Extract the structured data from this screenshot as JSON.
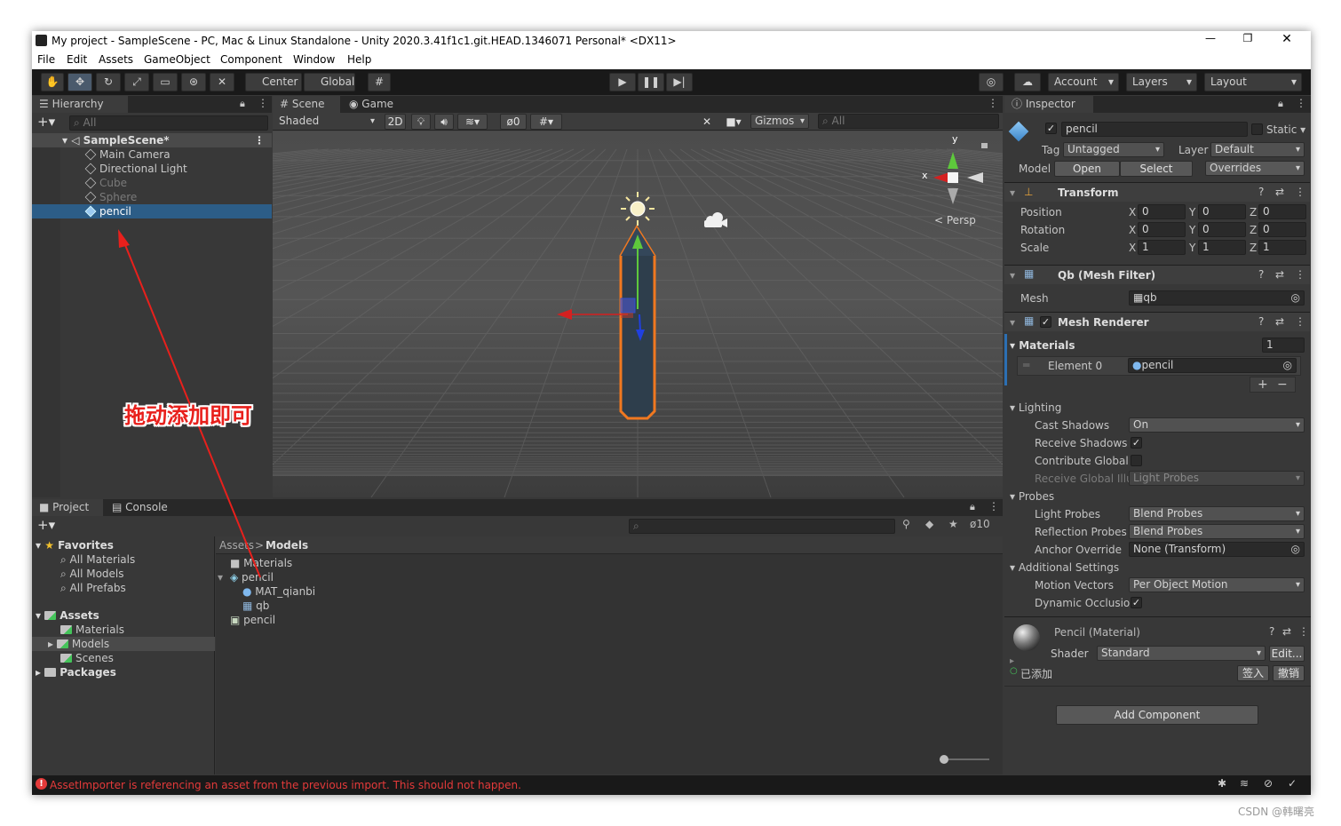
{
  "window": {
    "title": "My project - SampleScene - PC, Mac & Linux Standalone - Unity 2020.3.41f1c1.git.HEAD.1346071 Personal* <DX11>",
    "controls": {
      "minimize": "—",
      "maximize": "❐",
      "close": "✕"
    }
  },
  "menu": [
    "File",
    "Edit",
    "Assets",
    "GameObject",
    "Component",
    "Window",
    "Help"
  ],
  "toolbar": {
    "pivot": "Center",
    "space": "Global",
    "account": "Account",
    "layers": "Layers",
    "layout": "Layout"
  },
  "hierarchy": {
    "tab": "Hierarchy",
    "search_placeholder": "All",
    "scene": "SampleScene*",
    "items": [
      {
        "label": "Main Camera",
        "dim": false,
        "selected": false
      },
      {
        "label": "Directional Light",
        "dim": false,
        "selected": false
      },
      {
        "label": "Cube",
        "dim": true,
        "selected": false
      },
      {
        "label": "Sphere",
        "dim": true,
        "selected": false
      },
      {
        "label": "pencil",
        "dim": false,
        "selected": true
      }
    ]
  },
  "annotation": {
    "text": "拖动添加即可",
    "color": "#e8201c"
  },
  "scene_view": {
    "tabs": [
      "Scene",
      "Game"
    ],
    "shading": "Shaded",
    "mode_2d": "2D",
    "hidden_count": "0",
    "gizmos": "Gizmos",
    "search_placeholder": "All",
    "persp": "Persp",
    "axis_x": "x",
    "axis_y": "y"
  },
  "project": {
    "tabs": [
      "Project",
      "Console"
    ],
    "count": "10",
    "favorites_label": "Favorites",
    "favorites": [
      "All Materials",
      "All Models",
      "All Prefabs"
    ],
    "assets_label": "Assets",
    "assets": [
      "Materials",
      "Models",
      "Scenes"
    ],
    "packages_label": "Packages",
    "breadcrumb": [
      "Assets",
      "Models"
    ],
    "files": [
      {
        "label": "Materials",
        "indent": 0
      },
      {
        "label": "pencil",
        "indent": 0
      },
      {
        "label": "MAT_qianbi",
        "indent": 1
      },
      {
        "label": "qb",
        "indent": 1
      },
      {
        "label": "pencil",
        "indent": 0
      }
    ]
  },
  "inspector": {
    "tab": "Inspector",
    "object_name": "pencil",
    "static_label": "Static",
    "tag_label": "Tag",
    "tag_value": "Untagged",
    "layer_label": "Layer",
    "layer_value": "Default",
    "model_label": "Model",
    "model_buttons": [
      "Open",
      "Select",
      "Overrides"
    ],
    "transform": {
      "title": "Transform",
      "rows": [
        {
          "label": "Position",
          "x": "0",
          "y": "0",
          "z": "0"
        },
        {
          "label": "Rotation",
          "x": "0",
          "y": "0",
          "z": "0"
        },
        {
          "label": "Scale",
          "x": "1",
          "y": "1",
          "z": "1"
        }
      ]
    },
    "mesh_filter": {
      "title": "Qb (Mesh Filter)",
      "mesh_label": "Mesh",
      "mesh_value": "qb"
    },
    "mesh_renderer": {
      "title": "Mesh Renderer",
      "materials_label": "Materials",
      "materials_count": "1",
      "element_label": "Element 0",
      "element_value": "pencil",
      "lighting_label": "Lighting",
      "cast_shadows_label": "Cast Shadows",
      "cast_shadows_value": "On",
      "receive_shadows_label": "Receive Shadows",
      "contribute_gi_label": "Contribute Global I",
      "receive_gi_label": "Receive Global Illu",
      "receive_gi_value": "Light Probes",
      "probes_label": "Probes",
      "light_probes_label": "Light Probes",
      "light_probes_value": "Blend Probes",
      "reflection_probes_label": "Reflection Probes",
      "reflection_probes_value": "Blend Probes",
      "anchor_override_label": "Anchor Override",
      "anchor_override_value": "None (Transform)",
      "additional_label": "Additional Settings",
      "motion_vectors_label": "Motion Vectors",
      "motion_vectors_value": "Per Object Motion",
      "dynamic_occlusion_label": "Dynamic Occlusio"
    },
    "material": {
      "title": "Pencil (Material)",
      "shader_label": "Shader",
      "shader_value": "Standard",
      "edit_label": "Edit...",
      "added_label": "已添加",
      "checkin_label": "签入",
      "revert_label": "撤销"
    },
    "add_component": "Add Component"
  },
  "status": {
    "message": "AssetImporter is referencing an asset from the previous import. This should not happen.",
    "color": "#e43a3a"
  },
  "watermark": "CSDN @韩曙亮",
  "colors": {
    "selection": "#2c5d87",
    "accent_orange": "#f07820",
    "gizmo_green": "#5ec83c",
    "gizmo_red": "#d42020",
    "gizmo_blue": "#2040e0"
  }
}
